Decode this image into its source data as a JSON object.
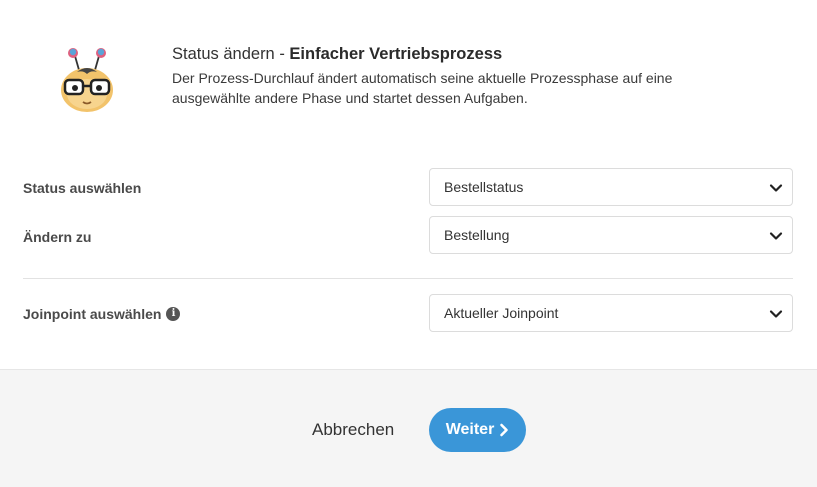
{
  "header": {
    "title_prefix": "Status ändern - ",
    "title_bold": "Einfacher Vertriebsprozess",
    "description": "Der Prozess-Durchlauf ändert automatisch seine aktuelle Prozessphase auf eine ausgewählte andere Phase und startet dessen Aufgaben.",
    "mascot_icon": "bee-mascot-with-glasses-icon"
  },
  "form": {
    "status": {
      "label": "Status auswählen",
      "value": "Bestellstatus"
    },
    "change_to": {
      "label": "Ändern zu",
      "value": "Bestellung"
    },
    "joinpoint": {
      "label": "Joinpoint auswählen",
      "info_icon": "info-icon",
      "value": "Aktueller Joinpoint"
    }
  },
  "footer": {
    "cancel_label": "Abbrechen",
    "next_label": "Weiter",
    "next_color": "#3a96d8"
  }
}
